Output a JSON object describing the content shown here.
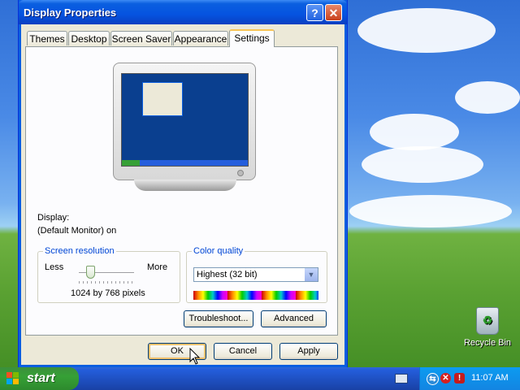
{
  "window": {
    "title": "Display Properties"
  },
  "tabs": [
    {
      "label": "Themes"
    },
    {
      "label": "Desktop"
    },
    {
      "label": "Screen Saver"
    },
    {
      "label": "Appearance"
    },
    {
      "label": "Settings"
    }
  ],
  "settings": {
    "display_label": "Display:",
    "display_value": "(Default Monitor) on",
    "screen_resolution": {
      "legend": "Screen resolution",
      "less": "Less",
      "more": "More",
      "value": "1024 by 768 pixels",
      "slider_position_fraction": 0.2
    },
    "color_quality": {
      "legend": "Color quality",
      "selected": "Highest (32 bit)"
    },
    "troubleshoot_label": "Troubleshoot...",
    "advanced_label": "Advanced"
  },
  "footer": {
    "ok_label": "OK",
    "cancel_label": "Cancel",
    "apply_label": "Apply"
  },
  "taskbar": {
    "start_label": "start",
    "clock": "11:07 AM"
  },
  "desktop": {
    "recycle_bin_label": "Recycle Bin"
  },
  "colors": {
    "title_blue": "#0a5fe0",
    "group_legend": "#0046d5",
    "taskbar_blue": "#245edc",
    "start_green": "#36a036"
  },
  "icons": {
    "help": "help-icon",
    "close": "close-icon",
    "start_logo": "windows-logo-icon",
    "recycle": "recycle-bin-icon"
  }
}
